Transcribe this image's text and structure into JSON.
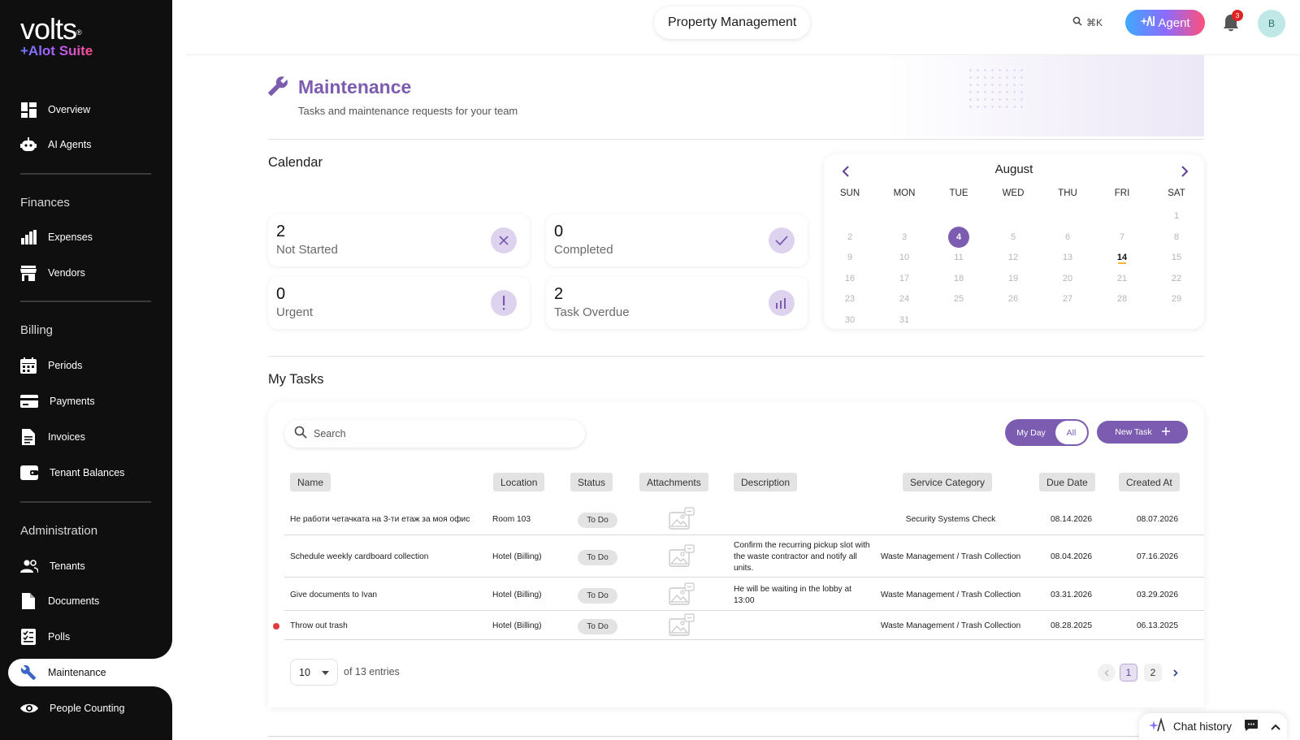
{
  "brand": {
    "name": "volts",
    "suite": "+Alot Suite"
  },
  "sidebar": {
    "top": [
      {
        "label": "Overview",
        "icon": "dashboard-icon"
      },
      {
        "label": "AI Agents",
        "icon": "robot-icon"
      }
    ],
    "finances_title": "Finances",
    "finances": [
      {
        "label": "Expenses",
        "icon": "bar-chart-icon"
      },
      {
        "label": "Vendors",
        "icon": "store-icon"
      }
    ],
    "billing_title": "Billing",
    "billing": [
      {
        "label": "Periods",
        "icon": "calendar-icon"
      },
      {
        "label": "Payments",
        "icon": "credit-card-icon"
      },
      {
        "label": "Invoices",
        "icon": "document-icon"
      },
      {
        "label": "Tenant Balances",
        "icon": "wallet-icon"
      }
    ],
    "admin_title": "Administration",
    "admin": [
      {
        "label": "Tenants",
        "icon": "people-icon"
      },
      {
        "label": "Documents",
        "icon": "file-icon"
      },
      {
        "label": "Polls",
        "icon": "checklist-icon"
      },
      {
        "label": "Maintenance",
        "icon": "wrench-icon"
      },
      {
        "label": "People Counting",
        "icon": "eye-icon"
      }
    ]
  },
  "topbar": {
    "title": "Property Management",
    "search_shortcut": "⌘K",
    "agent_label": "Agent",
    "notification_count": "3",
    "avatar_initial": "B"
  },
  "page": {
    "title": "Maintenance",
    "subtitle": "Tasks and maintenance requests for your team"
  },
  "calendar_section": {
    "title": "Calendar",
    "stats": [
      {
        "value": "2",
        "label": "Not Started",
        "icon": "x-icon"
      },
      {
        "value": "0",
        "label": "Completed",
        "icon": "check-icon"
      },
      {
        "value": "0",
        "label": "Urgent",
        "icon": "exclamation-icon"
      },
      {
        "value": "2",
        "label": "Task Overdue",
        "icon": "chart-icon"
      }
    ],
    "calendar": {
      "month": "August",
      "weekdays": [
        "SUN",
        "MON",
        "TUE",
        "WED",
        "THU",
        "FRI",
        "SAT"
      ],
      "first_weekday_index": 6,
      "days_in_month": 31,
      "selected_day": 4,
      "today": 14
    }
  },
  "tasks": {
    "title": "My Tasks",
    "search_placeholder": "Search",
    "toggle": {
      "my_day": "My Day",
      "all": "All",
      "active": "All"
    },
    "new_task_label": "New Task",
    "columns": [
      "Name",
      "Location",
      "Status",
      "Attachments",
      "Description",
      "Service Category",
      "Due Date",
      "Created At"
    ],
    "rows": [
      {
        "name": "Не работи четачката на 3-ти етаж за моя офис",
        "location": "Room 103",
        "status": "To Do",
        "description": "",
        "category": "Security Systems Check",
        "due": "08.14.2026",
        "created": "08.07.2026",
        "flag": false
      },
      {
        "name": "Schedule weekly cardboard collection",
        "location": "Hotel (Billing)",
        "status": "To Do",
        "description": "Confirm the recurring pickup slot with the waste contractor and notify all units.",
        "category": "Waste Management / Trash Collection",
        "due": "08.04.2026",
        "created": "07.16.2026",
        "flag": false
      },
      {
        "name": "Give documents to Ivan",
        "location": "Hotel (Billing)",
        "status": "To Do",
        "description": "He will be waiting in the lobby at 13:00",
        "category": "Waste Management / Trash Collection",
        "due": "03.31.2026",
        "created": "03.29.2026",
        "flag": false
      },
      {
        "name": "Throw out trash",
        "location": "Hotel (Billing)",
        "status": "To Do",
        "description": "",
        "category": "Waste Management / Trash Collection",
        "due": "08.28.2025",
        "created": "06.13.2025",
        "flag": true
      }
    ],
    "page_size": "10",
    "entries_text": "of 13 entries",
    "pages": [
      "1",
      "2"
    ],
    "current_page": "1"
  },
  "chat": {
    "label": "Chat history"
  },
  "colors": {
    "accent": "#7b5cb0",
    "sidebar_bg": "#0f0f0f",
    "flag": "#e23b3b"
  }
}
